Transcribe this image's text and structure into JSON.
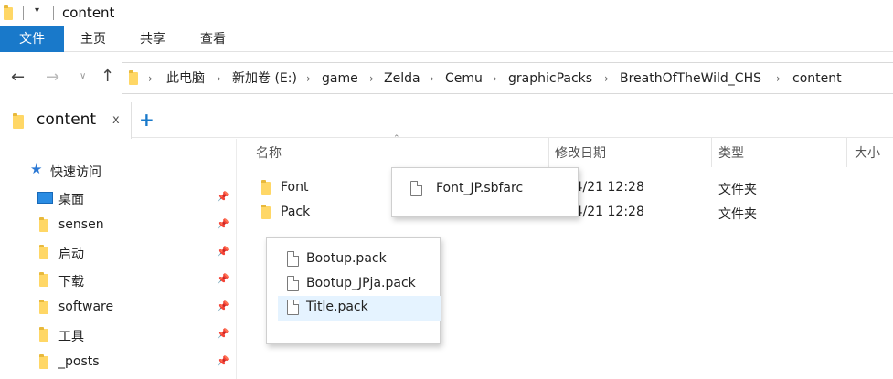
{
  "window": {
    "title": "content"
  },
  "ribbon": {
    "tabs": [
      "文件",
      "主页",
      "共享",
      "查看"
    ]
  },
  "address": {
    "crumbs": [
      "此电脑",
      "新加卷 (E:)",
      "game",
      "Zelda",
      "Cemu",
      "graphicPacks",
      "BreathOfTheWild_CHS",
      "content"
    ]
  },
  "tabbar": {
    "tab_label": "content",
    "close_glyph": "x",
    "new_tab_glyph": "+"
  },
  "sidebar": {
    "quick_access": "快速访问",
    "items": [
      "桌面",
      "sensen",
      "启动",
      "下载",
      "software",
      "工具",
      "_posts"
    ]
  },
  "columns": {
    "name": "名称",
    "date": "修改日期",
    "type": "类型",
    "size": "大小"
  },
  "rows": [
    {
      "name": "Font",
      "date": "3/4/21 12:28",
      "type": "文件夹"
    },
    {
      "name": "Pack",
      "date": "3/4/21 12:28",
      "type": "文件夹"
    }
  ],
  "popup_font": {
    "items": [
      "Font_JP.sbfarc"
    ]
  },
  "popup_pack": {
    "items": [
      "Bootup.pack",
      "Bootup_JPja.pack",
      "Title.pack"
    ],
    "selected": "Title.pack"
  },
  "colors": {
    "accent": "#1979ca",
    "selection": "#e5f3ff",
    "folder": "#ffd766"
  },
  "icons": [
    "folder-icon",
    "file-icon",
    "pin-icon",
    "star-icon",
    "desktop-icon",
    "back-arrow-icon",
    "forward-arrow-icon",
    "up-arrow-icon",
    "chevron-down-icon"
  ]
}
